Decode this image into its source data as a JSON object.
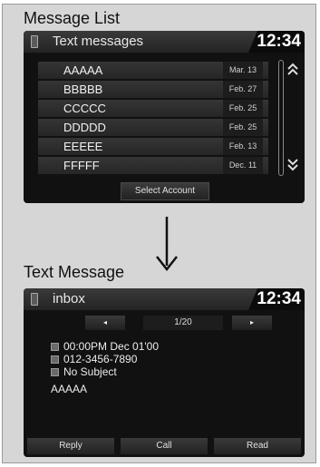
{
  "sections": {
    "message_list_title": "Message List",
    "text_message_title": "Text Message"
  },
  "list_screen": {
    "title": "Text messages",
    "clock": "12:34",
    "messages": [
      {
        "name": "AAAAA",
        "date": "Mar. 13"
      },
      {
        "name": "BBBBB",
        "date": "Feb. 27"
      },
      {
        "name": "CCCCC",
        "date": "Feb. 25"
      },
      {
        "name": "DDDDD",
        "date": "Feb. 25"
      },
      {
        "name": "EEEEE",
        "date": "Feb. 13"
      },
      {
        "name": "FFFFF",
        "date": "Dec. 11"
      }
    ],
    "scroll_up_icon": "double-chevron-up-icon",
    "scroll_down_icon": "double-chevron-down-icon",
    "select_account_label": "Select Account"
  },
  "arrow_icon": "down-arrow-icon",
  "detail_screen": {
    "title": "inbox",
    "clock": "12:34",
    "prev_glyph": "◂",
    "next_glyph": "▸",
    "page_indicator": "1/20",
    "datetime": "00:00PM Dec 01'00",
    "phone": "012-3456-7890",
    "subject": "No Subject",
    "body": "AAAAA",
    "buttons": {
      "reply": "Reply",
      "call": "Call",
      "read": "Read"
    }
  }
}
